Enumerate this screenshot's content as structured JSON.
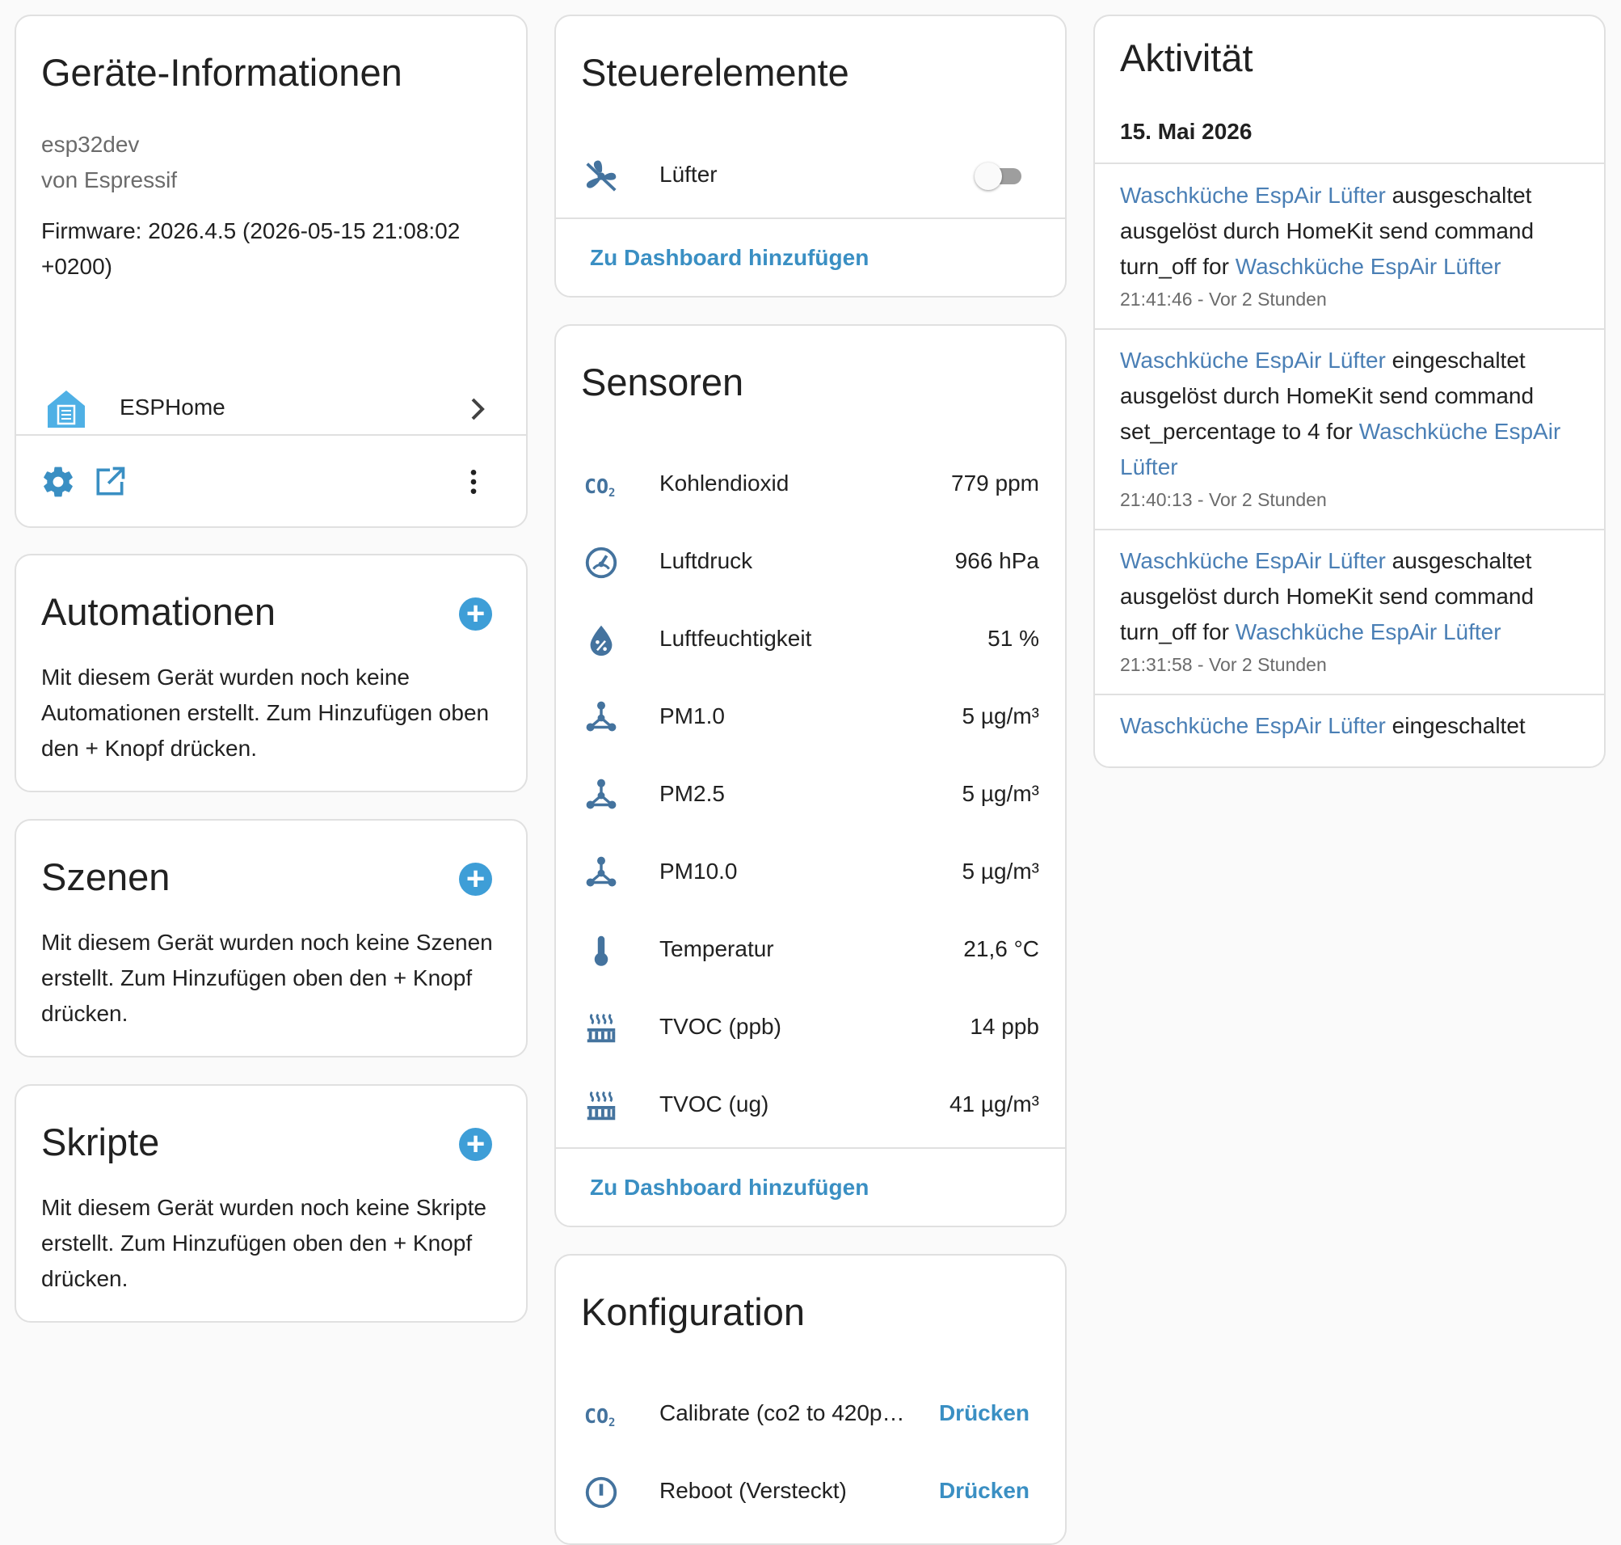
{
  "device_info": {
    "title": "Geräte-Informationen",
    "model": "esp32dev",
    "manufacturer": "von Espressif",
    "firmware": "Firmware: 2026.4.5 (2026-05-15 21:08:02 +0200)",
    "integration": {
      "label": "ESPHome",
      "icon": "esphome-house-icon"
    },
    "actions": {
      "settings_icon": "gear-icon",
      "visit_icon": "open-in-new-icon",
      "menu_icon": "dots-vertical-icon"
    }
  },
  "automations": {
    "title": "Automationen",
    "empty": "Mit diesem Gerät wurden noch keine Automationen erstellt. Zum Hinzufügen oben den + Knopf drücken."
  },
  "scenes": {
    "title": "Szenen",
    "empty": "Mit diesem Gerät wurden noch keine Szenen erstellt. Zum Hinzufügen oben den + Knopf drücken."
  },
  "scripts": {
    "title": "Skripte",
    "empty": "Mit diesem Gerät wurden noch keine Skripte erstellt. Zum Hinzufügen oben den + Knopf drücken."
  },
  "plus_symbol": "+",
  "controls": {
    "title": "Steuerelemente",
    "items": [
      {
        "icon": "fan-off-icon",
        "label": "Lüfter",
        "state": "off"
      }
    ],
    "add_to_dashboard": "Zu Dashboard hinzufügen"
  },
  "sensors": {
    "title": "Sensoren",
    "items": [
      {
        "icon": "co2-icon",
        "label": "Kohlendioxid",
        "value": "779 ppm"
      },
      {
        "icon": "gauge-icon",
        "label": "Luftdruck",
        "value": "966 hPa"
      },
      {
        "icon": "water-percent-icon",
        "label": "Luftfeuchtigkeit",
        "value": "51 %"
      },
      {
        "icon": "molecule-icon",
        "label": "PM1.0",
        "value": "5 µg/m³"
      },
      {
        "icon": "molecule-icon",
        "label": "PM2.5",
        "value": "5 µg/m³"
      },
      {
        "icon": "molecule-icon",
        "label": "PM10.0",
        "value": "5 µg/m³"
      },
      {
        "icon": "thermometer-icon",
        "label": "Temperatur",
        "value": "21,6 °C"
      },
      {
        "icon": "radiator-icon",
        "label": "TVOC (ppb)",
        "value": "14 ppb"
      },
      {
        "icon": "radiator-icon",
        "label": "TVOC (ug)",
        "value": "41 µg/m³"
      }
    ],
    "add_to_dashboard": "Zu Dashboard hinzufügen"
  },
  "configuration": {
    "title": "Konfiguration",
    "items": [
      {
        "icon": "co2-icon",
        "label": "Calibrate (co2 to 420p…",
        "action": "Drücken"
      },
      {
        "icon": "restart-icon",
        "label": "Reboot (Versteckt)",
        "action": "Drücken"
      }
    ]
  },
  "activity": {
    "title": "Aktivität",
    "date": "15. Mai 2026",
    "entries": [
      {
        "entity": "Waschküche EspAir Lüfter",
        "action": "ausgeschaltet",
        "by": "ausgelöst durch HomeKit send command turn_off for",
        "target": "Waschküche EspAir Lüfter",
        "time": "21:41:46 - Vor 2 Stunden"
      },
      {
        "entity": "Waschküche EspAir Lüfter",
        "action": "eingeschaltet",
        "by": "ausgelöst durch HomeKit send command set_percentage to 4 for",
        "target": "Waschküche EspAir Lüfter",
        "time": "21:40:13 - Vor 2 Stunden"
      },
      {
        "entity": "Waschküche EspAir Lüfter",
        "action": "ausgeschaltet",
        "by": "ausgelöst durch HomeKit send command turn_off for",
        "target": "Waschküche EspAir Lüfter",
        "time": "21:31:58 - Vor 2 Stunden"
      },
      {
        "entity": "Waschküche EspAir Lüfter",
        "action": "eingeschaltet"
      }
    ]
  },
  "colors": {
    "accent": "#3a8fc3",
    "icon": "#44739e",
    "link": "#4a7fb5",
    "card_border": "#e0e0e0",
    "background": "#fafafa"
  }
}
